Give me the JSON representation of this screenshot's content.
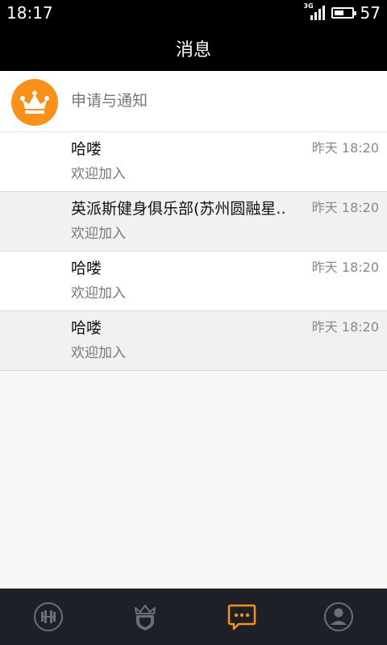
{
  "status_bar": {
    "time": "18:17",
    "network": "3G",
    "battery_level": "57",
    "battery_fraction": 0.57
  },
  "header": {
    "title": "消息"
  },
  "notification_entry": {
    "label": "申请与通知",
    "icon": "crown-icon",
    "icon_color": "#f7911c"
  },
  "messages": [
    {
      "name": "哈喽",
      "time": "昨天 18:20",
      "preview": "欢迎加入"
    },
    {
      "name": "英派斯健身俱乐部(苏州圆融星..",
      "time": "昨天 18:20",
      "preview": "欢迎加入"
    },
    {
      "name": "哈喽",
      "time": "昨天 18:20",
      "preview": "欢迎加入"
    },
    {
      "name": "哈喽",
      "time": "昨天 18:20",
      "preview": "欢迎加入"
    }
  ],
  "tabs": [
    {
      "icon": "dumbbell-icon",
      "active": false
    },
    {
      "icon": "shield-crown-icon",
      "active": false
    },
    {
      "icon": "chat-bubble-icon",
      "active": true
    },
    {
      "icon": "profile-icon",
      "active": false
    }
  ],
  "colors": {
    "accent": "#f7911c",
    "tab_inactive": "#6b6f77",
    "tab_bar_bg": "#1d2027"
  }
}
